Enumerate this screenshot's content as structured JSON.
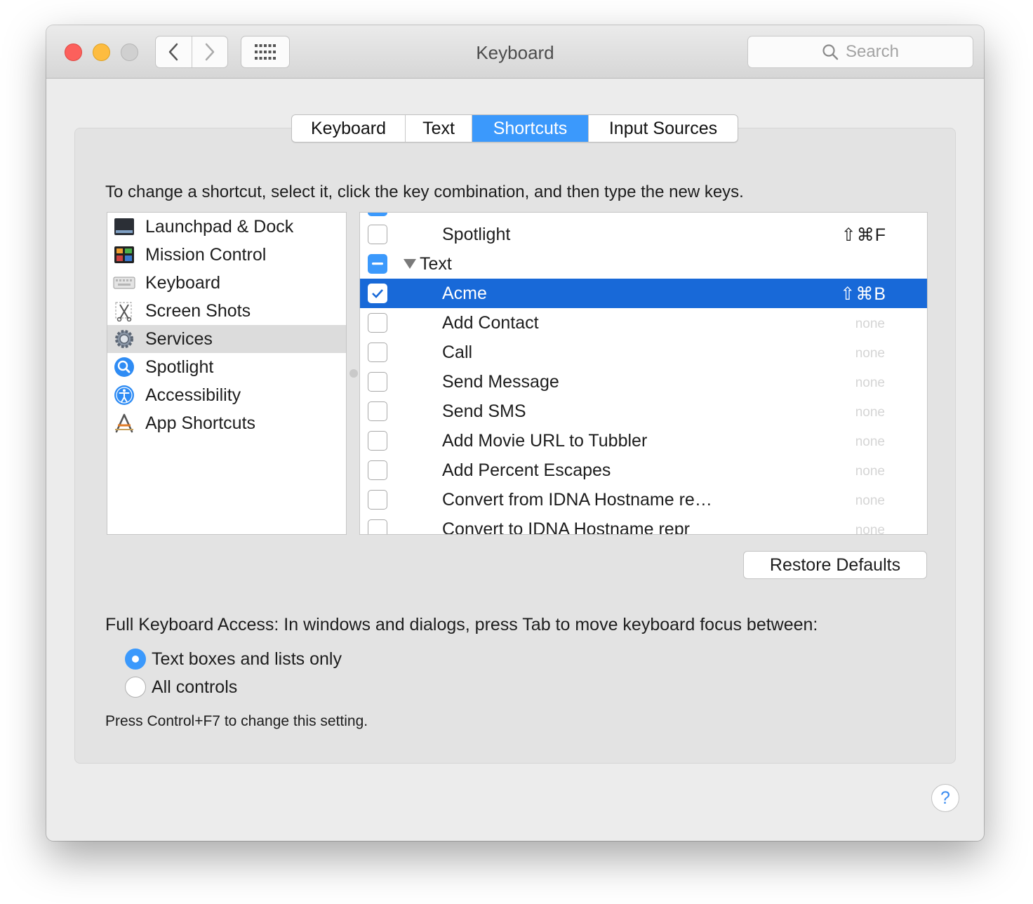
{
  "window": {
    "title": "Keyboard"
  },
  "search": {
    "placeholder": "Search"
  },
  "tabs": [
    {
      "label": "Keyboard"
    },
    {
      "label": "Text"
    },
    {
      "label": "Shortcuts"
    },
    {
      "label": "Input Sources"
    }
  ],
  "active_tab": "Shortcuts",
  "instruction": "To change a shortcut, select it, click the key combination, and then type the new keys.",
  "categories": [
    {
      "label": "Launchpad & Dock",
      "icon": "launchpad-dock-icon"
    },
    {
      "label": "Mission Control",
      "icon": "mission-control-icon"
    },
    {
      "label": "Keyboard",
      "icon": "keyboard-icon"
    },
    {
      "label": "Screen Shots",
      "icon": "screenshot-icon"
    },
    {
      "label": "Services",
      "icon": "gear-icon",
      "selected": true
    },
    {
      "label": "Spotlight",
      "icon": "spotlight-icon"
    },
    {
      "label": "Accessibility",
      "icon": "accessibility-icon"
    },
    {
      "label": "App Shortcuts",
      "icon": "app-shortcuts-icon"
    }
  ],
  "shortcuts": {
    "spotlight": {
      "label": "Spotlight",
      "key": "⇧⌘F",
      "checked": false
    },
    "text_group": {
      "label": "Text",
      "state": "mixed"
    },
    "items": [
      {
        "label": "Acme",
        "key": "⇧⌘B",
        "checked": true,
        "selected": true
      },
      {
        "label": "Add Contact",
        "key": "none",
        "checked": false
      },
      {
        "label": "Call",
        "key": "none",
        "checked": false
      },
      {
        "label": "Send Message",
        "key": "none",
        "checked": false
      },
      {
        "label": "Send SMS",
        "key": "none",
        "checked": false
      },
      {
        "label": "Add Movie URL to Tubbler",
        "key": "none",
        "checked": false
      },
      {
        "label": "Add Percent Escapes",
        "key": "none",
        "checked": false
      },
      {
        "label": "Convert from IDNA Hostname re…",
        "key": "none",
        "checked": false
      },
      {
        "label": "Convert to IDNA Hostname repr",
        "key": "none",
        "checked": false
      }
    ]
  },
  "restore_defaults": "Restore Defaults",
  "full_keyboard_access": {
    "label": "Full Keyboard Access: In windows and dialogs, press Tab to move keyboard focus between:",
    "options": [
      {
        "label": "Text boxes and lists only",
        "selected": true
      },
      {
        "label": "All controls",
        "selected": false
      }
    ],
    "hint": "Press Control+F7 to change this setting."
  },
  "help": "?",
  "colors": {
    "accent": "#3b99fc",
    "selection": "#1869d8",
    "close": "#fc605c",
    "minimize": "#fdbc40"
  }
}
